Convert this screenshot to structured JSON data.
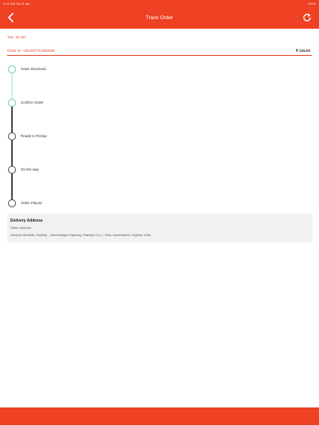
{
  "status_bar": {
    "time": "9:41 AM  Tue 8 Jan",
    "battery": "100%"
  },
  "header": {
    "title": "Track Order",
    "back_icon": "chevron-left-icon",
    "refresh_icon": "refresh-icon"
  },
  "order": {
    "date": "Tue, 15 Jan",
    "id_label": "Order Id : OD1637713000929",
    "total": "₹ 215.00"
  },
  "tracking": {
    "steps": [
      {
        "label": "Order Received",
        "status": "done"
      },
      {
        "label": "Confirm Order",
        "status": "done"
      },
      {
        "label": "Ready to Pickup",
        "status": "pending"
      },
      {
        "label": "On the way",
        "status": "pending"
      },
      {
        "label": "Order Placed",
        "status": "pending"
      }
    ]
  },
  "delivery": {
    "title": "Delivery Address",
    "type": "Office Address",
    "address": "Ganesh Meridian, Sarkhej - Gandhinagar Highway, Railway Cry 1, Sola, Ahmedabad, Gujarat, India"
  },
  "colors": {
    "accent": "#ef4123",
    "done": "#6fcf97",
    "pending": "#3e4a55",
    "address_bg": "#f1f1f3"
  }
}
